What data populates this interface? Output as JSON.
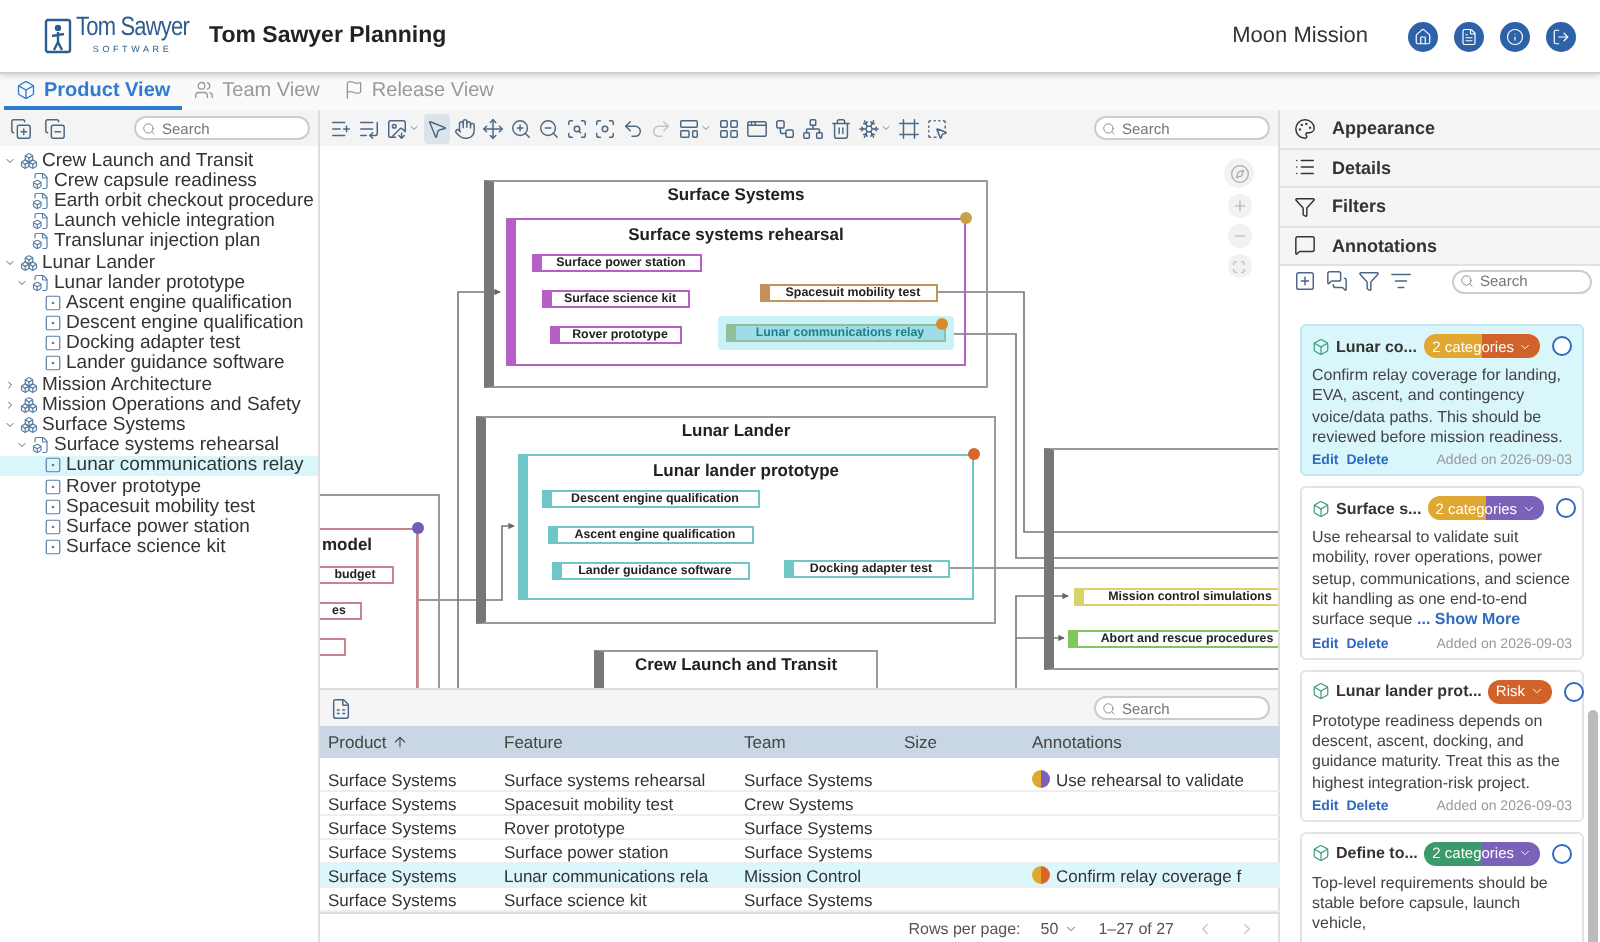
{
  "header": {
    "logo": {
      "name": "Tom Sawyer",
      "tagline": "SOFTWARE"
    },
    "title": "Tom Sawyer Planning",
    "project": "Moon Mission"
  },
  "tabs": [
    {
      "label": "Product View",
      "selected": true
    },
    {
      "label": "Team View",
      "selected": false
    },
    {
      "label": "Release View",
      "selected": false
    }
  ],
  "tree_panel": {
    "search": {
      "placeholder": "Search"
    },
    "items": [
      {
        "label": "Crew Launch and Transit",
        "expanded": true,
        "selected": false,
        "children": [
          {
            "label": "Crew capsule readiness",
            "selected": false
          },
          {
            "label": "Earth orbit checkout procedure",
            "selected": false
          },
          {
            "label": "Launch vehicle integration",
            "selected": false
          },
          {
            "label": "Translunar injection plan",
            "selected": false
          }
        ]
      },
      {
        "label": "Lunar Lander",
        "expanded": true,
        "selected": false,
        "children": [
          {
            "label": "Lunar lander prototype",
            "expanded": true,
            "selected": false,
            "children": [
              {
                "label": "Ascent engine qualification",
                "selected": false
              },
              {
                "label": "Descent engine qualification",
                "selected": false
              },
              {
                "label": "Docking adapter test",
                "selected": false
              },
              {
                "label": "Lander guidance software",
                "selected": false
              }
            ]
          }
        ]
      },
      {
        "label": "Mission Architecture",
        "expanded": false,
        "selected": false
      },
      {
        "label": "Mission Operations and Safety",
        "expanded": false,
        "selected": false
      },
      {
        "label": "Surface Systems",
        "expanded": true,
        "selected": false,
        "children": [
          {
            "label": "Surface systems rehearsal",
            "expanded": true,
            "selected": false,
            "children": [
              {
                "label": "Lunar communications relay",
                "selected": true
              },
              {
                "label": "Rover prototype",
                "selected": false
              },
              {
                "label": "Spacesuit mobility test",
                "selected": false
              },
              {
                "label": "Surface power station",
                "selected": false
              },
              {
                "label": "Surface science kit",
                "selected": false
              }
            ]
          }
        ]
      }
    ]
  },
  "diagram_toolbar": {
    "tools": [
      {
        "selected": false,
        "disabled": false
      },
      {
        "selected": false,
        "disabled": false
      },
      {
        "selected": false,
        "disabled": false
      },
      {
        "selected": true,
        "disabled": false
      },
      {
        "selected": false,
        "disabled": false
      },
      {
        "selected": false,
        "disabled": false
      },
      {
        "selected": false,
        "disabled": false
      },
      {
        "selected": false,
        "disabled": false
      },
      {
        "selected": false,
        "disabled": false
      },
      {
        "selected": false,
        "disabled": false
      },
      {
        "selected": false,
        "disabled": false
      },
      {
        "selected": false,
        "disabled": true
      },
      {
        "selected": false,
        "disabled": false
      },
      {
        "selected": false,
        "disabled": false
      },
      {
        "selected": false,
        "disabled": false
      },
      {
        "selected": false,
        "disabled": false
      },
      {
        "selected": false,
        "disabled": false
      },
      {
        "selected": false,
        "disabled": false
      },
      {
        "selected": false,
        "disabled": false
      },
      {
        "selected": false,
        "disabled": false
      },
      {
        "selected": false,
        "disabled": false
      }
    ],
    "search": {
      "placeholder": "Search"
    }
  },
  "diagram": {
    "groups": [
      {
        "title": "Surface Systems",
        "features": [
          {
            "title": "Surface systems rehearsal",
            "color": "#b65fc6",
            "annotation": {
              "color": "#c9a04a"
            },
            "tasks": [
              {
                "label": "Surface power station",
                "color": "#b65fc6",
                "selected": false
              },
              {
                "label": "Surface science kit",
                "color": "#b65fc6",
                "selected": false
              },
              {
                "label": "Rover prototype",
                "color": "#b65fc6",
                "selected": false
              },
              {
                "label": "Spacesuit mobility test",
                "color": "#c4915a",
                "selected": false
              },
              {
                "label": "Lunar communications relay",
                "color": "#8fbf9a",
                "selected": true,
                "annotation": {
                  "color": "#d98a2b"
                }
              }
            ]
          }
        ]
      },
      {
        "title": "Lunar Lander",
        "features": [
          {
            "title": "Lunar lander prototype",
            "color": "#6ec6c6",
            "annotation": {
              "color": "#d9662b"
            },
            "tasks": [
              {
                "label": "Descent engine qualification",
                "color": "#6ec6c6",
                "selected": false
              },
              {
                "label": "Ascent engine qualification",
                "color": "#6ec6c6",
                "selected": false
              },
              {
                "label": "Lander guidance software",
                "color": "#6ec6c6",
                "selected": false
              },
              {
                "label": "Docking adapter test",
                "color": "#6ec6c6",
                "selected": false
              }
            ]
          }
        ]
      },
      {
        "title": "Crew Launch and Transit"
      },
      {
        "tasks": [
          {
            "label": "Mission control simulations",
            "color": "#d8d46a",
            "selected": false
          },
          {
            "label": "Abort and rescue procedures",
            "color": "#7fc85e",
            "selected": false
          }
        ]
      },
      {
        "features": [
          {
            "title": "model",
            "color": "#c8848e",
            "annotation": {
              "color": "#6f5fb4"
            },
            "tasks": [
              {
                "label": "budget",
                "color": "#c8848e",
                "selected": false
              },
              {
                "label": "es",
                "color": "#c8848e",
                "selected": false
              },
              {
                "color": "#c8848e",
                "selected": false
              }
            ]
          }
        ]
      }
    ]
  },
  "table": {
    "search": {
      "placeholder": "Search"
    },
    "columns": [
      {
        "label": "Product",
        "sorted": true
      },
      {
        "label": "Feature",
        "sorted": false
      },
      {
        "label": "Team",
        "sorted": false
      },
      {
        "label": "Size",
        "sorted": false
      },
      {
        "label": "Annotations",
        "sorted": false
      }
    ],
    "rows": [
      {
        "product": "Surface Systems",
        "feature": "Surface systems rehearsal",
        "team": "Surface Systems",
        "selected": false,
        "annotation": {
          "text": "Use rehearsal to validate",
          "segments": [
            {
              "color": "#e0a830"
            },
            {
              "color": "#7a62b8"
            }
          ]
        }
      },
      {
        "product": "Surface Systems",
        "feature": "Spacesuit mobility test",
        "team": "Crew Systems",
        "selected": false
      },
      {
        "product": "Surface Systems",
        "feature": "Rover prototype",
        "team": "Surface Systems",
        "selected": false
      },
      {
        "product": "Surface Systems",
        "feature": "Surface power station",
        "team": "Surface Systems",
        "selected": false
      },
      {
        "product": "Surface Systems",
        "feature": "Lunar communications rela",
        "team": "Mission Control",
        "selected": true,
        "annotation": {
          "text": "Confirm relay coverage f",
          "segments": [
            {
              "color": "#e0a830"
            },
            {
              "color": "#d9662b"
            }
          ]
        }
      },
      {
        "product": "Surface Systems",
        "feature": "Surface science kit",
        "team": "Surface Systems",
        "selected": false
      }
    ],
    "footer": {
      "rows_label": "Rows per page:",
      "rows_value": "50",
      "range": "1–27 of 27"
    }
  },
  "side_panel": {
    "sections": [
      {
        "label": "Appearance"
      },
      {
        "label": "Details"
      },
      {
        "label": "Filters"
      },
      {
        "label": "Annotations"
      }
    ],
    "search": {
      "placeholder": "Search"
    },
    "cards": [
      {
        "title": "Lunar co...",
        "tag": {
          "label": "2 categories",
          "segments": [
            {
              "color": "#e0a830"
            },
            {
              "color": "#d0622a"
            }
          ]
        },
        "checked": false,
        "selected": true,
        "body": "Confirm relay coverage for landing, EVA, ascent, and contingency voice/data paths. This should be reviewed before mission readiness.",
        "edit": "Edit",
        "delete": "Delete",
        "added": "Added on 2026-09-03"
      },
      {
        "title": "Surface s...",
        "tag": {
          "label": "2 categories",
          "segments": [
            {
              "color": "#e0a830"
            },
            {
              "color": "#7a62b8"
            }
          ]
        },
        "checked": false,
        "selected": false,
        "body": "Use rehearsal to validate suit mobility, rover operations, power setup, communications, and science kit handling as one end-to-end surface seque",
        "more": "... Show More",
        "edit": "Edit",
        "delete": "Delete",
        "added": "Added on 2026-09-03"
      },
      {
        "title": "Lunar lander prot...",
        "tag": {
          "label": "Risk",
          "segments": [
            {
              "color": "#d0622a"
            }
          ]
        },
        "checked": false,
        "selected": false,
        "body": "Prototype readiness depends on descent, ascent, docking, and guidance maturity. Treat this as the highest integration-risk project.",
        "edit": "Edit",
        "delete": "Delete",
        "added": "Added on 2026-09-03"
      },
      {
        "title": "Define to...",
        "tag": {
          "label": "2 categories",
          "segments": [
            {
              "color": "#3a9a6a"
            },
            {
              "color": "#7a62b8"
            }
          ]
        },
        "checked": false,
        "selected": false,
        "body": "Top-level requirements should be stable before capsule, launch vehicle,"
      }
    ]
  }
}
